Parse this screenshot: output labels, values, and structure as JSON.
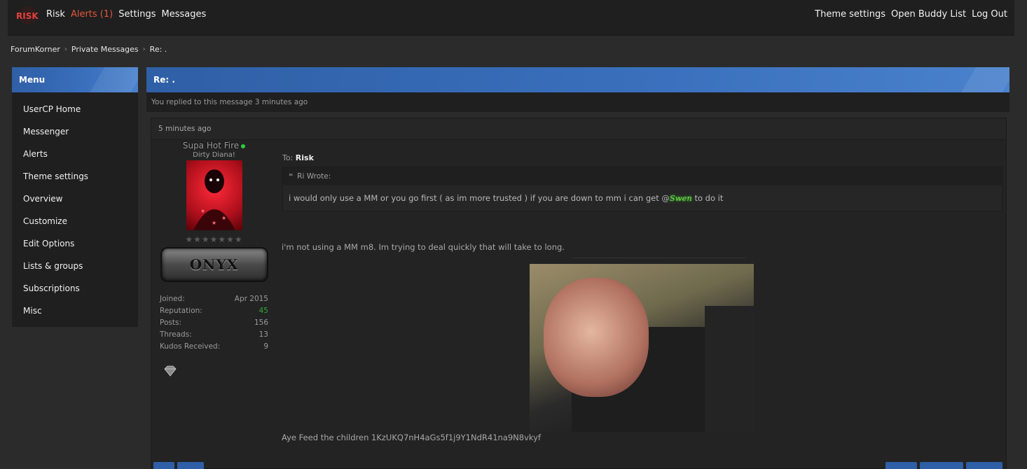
{
  "topbar": {
    "logo_text": "RISK",
    "left_links": [
      "Risk",
      "Alerts (1)",
      "Settings",
      "Messages"
    ],
    "right_links": [
      "Theme settings",
      "Open Buddy List",
      "Log Out"
    ]
  },
  "breadcrumb": [
    "ForumKorner",
    "Private Messages",
    "Re: ."
  ],
  "sidebar": {
    "title": "Menu",
    "items": [
      "UserCP Home",
      "Messenger",
      "Alerts",
      "Theme settings",
      "Overview",
      "Customize",
      "Edit Options",
      "Lists & groups",
      "Subscriptions",
      "Misc"
    ]
  },
  "thread": {
    "title": "Re: .",
    "note": "You replied to this message 3 minutes ago"
  },
  "post": {
    "time": "5 minutes ago",
    "author": {
      "name": "Supa Hot Fire",
      "title": "Dirty Diana!",
      "rank_label": "ONYX",
      "stats": [
        {
          "label": "Joined:",
          "value": "Apr 2015"
        },
        {
          "label": "Reputation:",
          "value": "45"
        },
        {
          "label": "Posts:",
          "value": "156"
        },
        {
          "label": "Threads:",
          "value": "13"
        },
        {
          "label": "Kudos Received:",
          "value": "9"
        }
      ]
    },
    "to_label": "To:",
    "to_user": "Risk",
    "quote": {
      "author_line": "Ri Wrote:",
      "text_before": "i would only use a MM or you go first ( as im more trusted ) if you are down to mm i can get @",
      "mention": "Swen",
      "text_after": " to do it"
    },
    "reply_text": "i'm not using a MM m8. Im trying to deal quickly that will take to long.",
    "signature": "Aye Feed the children 1KzUKQ7nH4aGs5f1j9Y1NdR41na9N8vkyf"
  },
  "colors": {
    "accent_blue": "#3a70bd",
    "alert_red": "#e2563c",
    "reputation_green": "#36a836",
    "online_green": "#2ecc40"
  }
}
